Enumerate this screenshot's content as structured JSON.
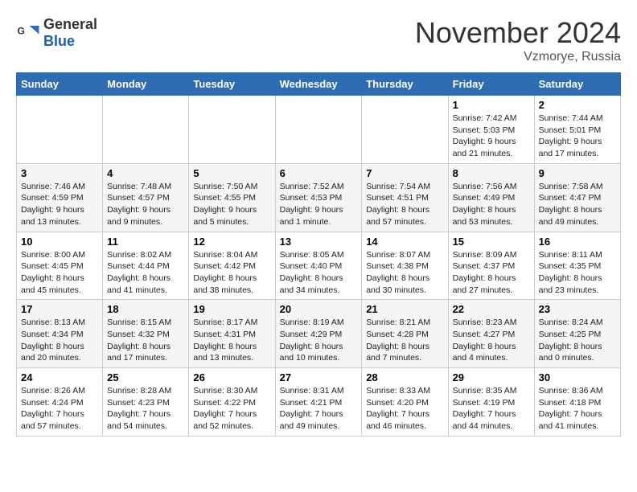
{
  "logo": {
    "text_general": "General",
    "text_blue": "Blue"
  },
  "title": {
    "month": "November 2024",
    "location": "Vzmorye, Russia"
  },
  "weekdays": [
    "Sunday",
    "Monday",
    "Tuesday",
    "Wednesday",
    "Thursday",
    "Friday",
    "Saturday"
  ],
  "weeks": [
    [
      {
        "day": "",
        "info": ""
      },
      {
        "day": "",
        "info": ""
      },
      {
        "day": "",
        "info": ""
      },
      {
        "day": "",
        "info": ""
      },
      {
        "day": "",
        "info": ""
      },
      {
        "day": "1",
        "info": "Sunrise: 7:42 AM\nSunset: 5:03 PM\nDaylight: 9 hours\nand 21 minutes."
      },
      {
        "day": "2",
        "info": "Sunrise: 7:44 AM\nSunset: 5:01 PM\nDaylight: 9 hours\nand 17 minutes."
      }
    ],
    [
      {
        "day": "3",
        "info": "Sunrise: 7:46 AM\nSunset: 4:59 PM\nDaylight: 9 hours\nand 13 minutes."
      },
      {
        "day": "4",
        "info": "Sunrise: 7:48 AM\nSunset: 4:57 PM\nDaylight: 9 hours\nand 9 minutes."
      },
      {
        "day": "5",
        "info": "Sunrise: 7:50 AM\nSunset: 4:55 PM\nDaylight: 9 hours\nand 5 minutes."
      },
      {
        "day": "6",
        "info": "Sunrise: 7:52 AM\nSunset: 4:53 PM\nDaylight: 9 hours\nand 1 minute."
      },
      {
        "day": "7",
        "info": "Sunrise: 7:54 AM\nSunset: 4:51 PM\nDaylight: 8 hours\nand 57 minutes."
      },
      {
        "day": "8",
        "info": "Sunrise: 7:56 AM\nSunset: 4:49 PM\nDaylight: 8 hours\nand 53 minutes."
      },
      {
        "day": "9",
        "info": "Sunrise: 7:58 AM\nSunset: 4:47 PM\nDaylight: 8 hours\nand 49 minutes."
      }
    ],
    [
      {
        "day": "10",
        "info": "Sunrise: 8:00 AM\nSunset: 4:45 PM\nDaylight: 8 hours\nand 45 minutes."
      },
      {
        "day": "11",
        "info": "Sunrise: 8:02 AM\nSunset: 4:44 PM\nDaylight: 8 hours\nand 41 minutes."
      },
      {
        "day": "12",
        "info": "Sunrise: 8:04 AM\nSunset: 4:42 PM\nDaylight: 8 hours\nand 38 minutes."
      },
      {
        "day": "13",
        "info": "Sunrise: 8:05 AM\nSunset: 4:40 PM\nDaylight: 8 hours\nand 34 minutes."
      },
      {
        "day": "14",
        "info": "Sunrise: 8:07 AM\nSunset: 4:38 PM\nDaylight: 8 hours\nand 30 minutes."
      },
      {
        "day": "15",
        "info": "Sunrise: 8:09 AM\nSunset: 4:37 PM\nDaylight: 8 hours\nand 27 minutes."
      },
      {
        "day": "16",
        "info": "Sunrise: 8:11 AM\nSunset: 4:35 PM\nDaylight: 8 hours\nand 23 minutes."
      }
    ],
    [
      {
        "day": "17",
        "info": "Sunrise: 8:13 AM\nSunset: 4:34 PM\nDaylight: 8 hours\nand 20 minutes."
      },
      {
        "day": "18",
        "info": "Sunrise: 8:15 AM\nSunset: 4:32 PM\nDaylight: 8 hours\nand 17 minutes."
      },
      {
        "day": "19",
        "info": "Sunrise: 8:17 AM\nSunset: 4:31 PM\nDaylight: 8 hours\nand 13 minutes."
      },
      {
        "day": "20",
        "info": "Sunrise: 8:19 AM\nSunset: 4:29 PM\nDaylight: 8 hours\nand 10 minutes."
      },
      {
        "day": "21",
        "info": "Sunrise: 8:21 AM\nSunset: 4:28 PM\nDaylight: 8 hours\nand 7 minutes."
      },
      {
        "day": "22",
        "info": "Sunrise: 8:23 AM\nSunset: 4:27 PM\nDaylight: 8 hours\nand 4 minutes."
      },
      {
        "day": "23",
        "info": "Sunrise: 8:24 AM\nSunset: 4:25 PM\nDaylight: 8 hours\nand 0 minutes."
      }
    ],
    [
      {
        "day": "24",
        "info": "Sunrise: 8:26 AM\nSunset: 4:24 PM\nDaylight: 7 hours\nand 57 minutes."
      },
      {
        "day": "25",
        "info": "Sunrise: 8:28 AM\nSunset: 4:23 PM\nDaylight: 7 hours\nand 54 minutes."
      },
      {
        "day": "26",
        "info": "Sunrise: 8:30 AM\nSunset: 4:22 PM\nDaylight: 7 hours\nand 52 minutes."
      },
      {
        "day": "27",
        "info": "Sunrise: 8:31 AM\nSunset: 4:21 PM\nDaylight: 7 hours\nand 49 minutes."
      },
      {
        "day": "28",
        "info": "Sunrise: 8:33 AM\nSunset: 4:20 PM\nDaylight: 7 hours\nand 46 minutes."
      },
      {
        "day": "29",
        "info": "Sunrise: 8:35 AM\nSunset: 4:19 PM\nDaylight: 7 hours\nand 44 minutes."
      },
      {
        "day": "30",
        "info": "Sunrise: 8:36 AM\nSunset: 4:18 PM\nDaylight: 7 hours\nand 41 minutes."
      }
    ]
  ]
}
